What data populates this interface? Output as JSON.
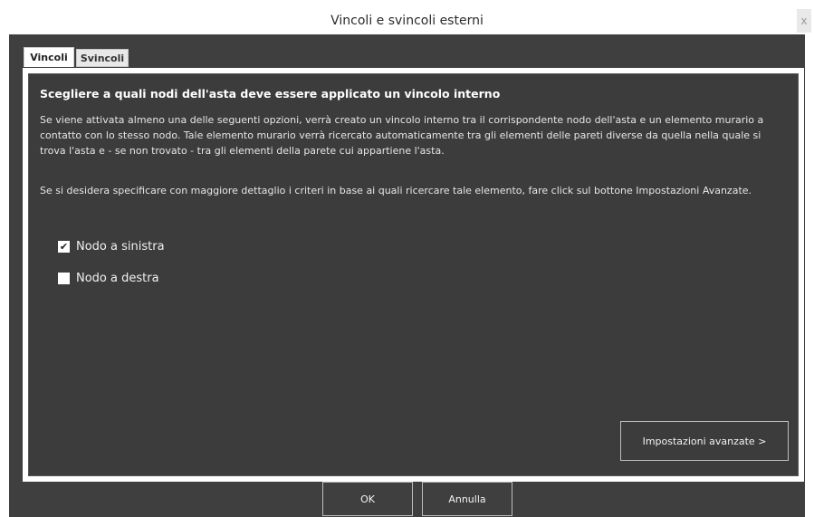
{
  "window": {
    "title": "Vincoli e svincoli esterni",
    "close_glyph": "x"
  },
  "tabs": [
    {
      "label": "Vincoli",
      "active": true
    },
    {
      "label": "Svincoli",
      "active": false
    }
  ],
  "panel": {
    "heading": "Scegliere a quali nodi dell'asta deve essere applicato un vincolo interno",
    "paragraph1": "Se viene attivata almeno una delle seguenti opzioni, verrà creato un vincolo interno tra il corrispondente nodo dell'asta e un elemento murario a contatto con lo stesso nodo. Tale elemento murario verrà ricercato automaticamente tra gli elementi delle pareti diverse da quella nella quale si trova l'asta e - se non trovato - tra gli elementi della parete cui appartiene l'asta.",
    "paragraph2": "Se si desidera specificare con maggiore dettaglio i criteri in base ai quali ricercare tale elemento, fare click sul bottone Impostazioni Avanzate.",
    "options": [
      {
        "label": "Nodo a sinistra",
        "checked": true
      },
      {
        "label": "Nodo a destra",
        "checked": false
      }
    ],
    "advanced_button": "Impostazioni avanzate >"
  },
  "footer": {
    "ok_label": "OK",
    "cancel_label": "Annulla"
  },
  "colors": {
    "background": "#3f3f3f",
    "panel": "#3c3c3c",
    "text": "#ffffff"
  }
}
